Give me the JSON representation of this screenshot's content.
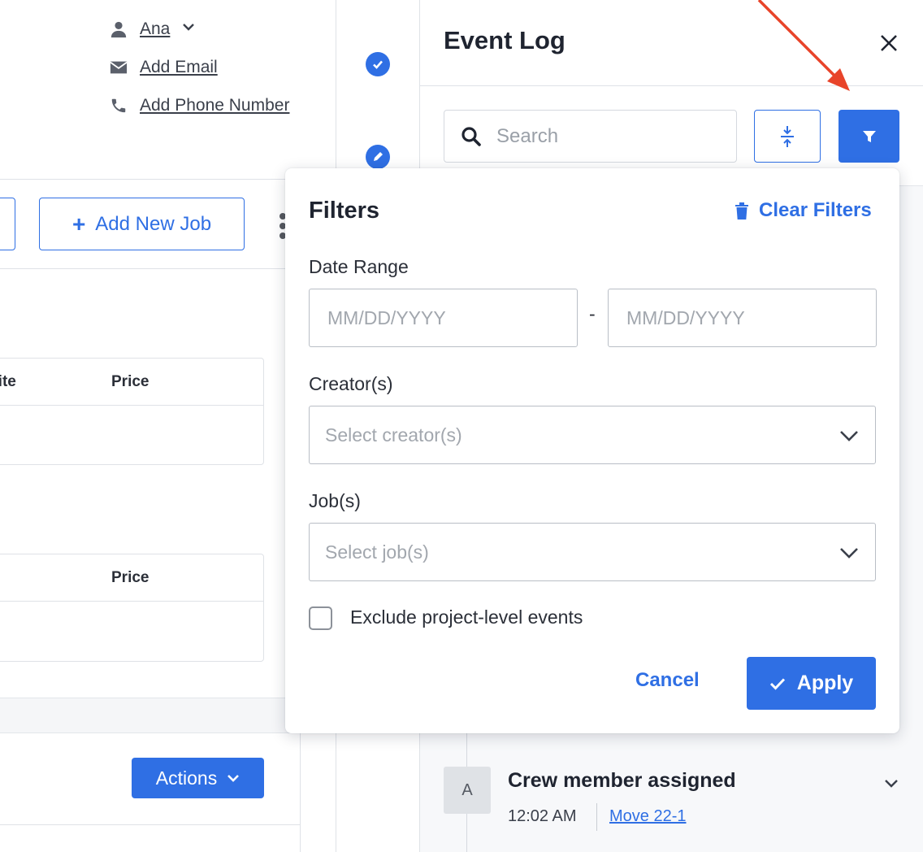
{
  "colors": {
    "accent": "#2f6fe4",
    "arrow": "#e8442a",
    "border": "#dfe2e7",
    "muted_text": "#a2a7ae"
  },
  "contact": {
    "name": "Ana",
    "email_link": "Add Email",
    "phone_link": "Add Phone Number"
  },
  "jobs": {
    "add_job_label": "Add New Job",
    "tables": [
      {
        "columns": [
          "Site",
          "Price"
        ]
      },
      {
        "columns": [
          "",
          "Price"
        ]
      }
    ],
    "actions_label": "Actions"
  },
  "event_log": {
    "title": "Event Log",
    "search_placeholder": "Search",
    "items": [
      {
        "avatar_initial": "A",
        "title": "Crew member assigned",
        "time": "12:02 AM",
        "job_link": "Move 22-1"
      }
    ]
  },
  "filters": {
    "title": "Filters",
    "clear_label": "Clear Filters",
    "date_range_label": "Date Range",
    "date_from_placeholder": "MM/DD/YYYY",
    "date_separator": "-",
    "date_to_placeholder": "MM/DD/YYYY",
    "creators_label": "Creator(s)",
    "creators_placeholder": "Select creator(s)",
    "jobs_label": "Job(s)",
    "jobs_placeholder": "Select job(s)",
    "exclude_label": "Exclude project-level events",
    "exclude_checked": false,
    "cancel_label": "Cancel",
    "apply_label": "Apply"
  },
  "icons": {
    "contact_name": "user-icon",
    "contact_email": "envelope-icon",
    "contact_phone": "phone-icon",
    "rail_top": "check-circle-icon",
    "rail_second": "pencil-chat-icon",
    "search": "search-icon",
    "expand": "expand-collapse-icon",
    "filter": "filter-funnel-icon",
    "close": "close-icon",
    "clear": "trash-icon",
    "apply": "checkmark-icon"
  }
}
